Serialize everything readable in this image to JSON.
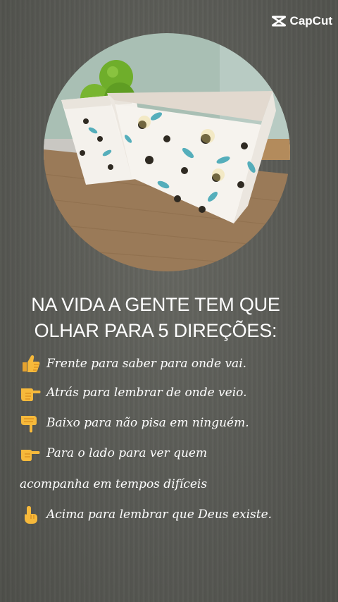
{
  "watermark": {
    "brand": "CapCut",
    "icon": "capcut-logo-icon"
  },
  "photo": {
    "icon": "ceramic-planters-photo"
  },
  "headline": {
    "line1": "NA VIDA A GENTE TEM QUE",
    "line2": "OLHAR PARA 5 DIREÇÕES:"
  },
  "directions": [
    {
      "emoji": "thumbs-up-icon",
      "text": "Frente para saber para onde vai."
    },
    {
      "emoji": "pointing-right-icon",
      "text": "Atrás para lembrar de onde veio."
    },
    {
      "emoji": "pointing-down-icon",
      "text": "Baixo para não pisa em ninguém."
    },
    {
      "emoji": "pointing-side-icon",
      "text": "Para o lado para ver quem"
    },
    {
      "emoji": "",
      "text": "acompanha em tempos difíceis"
    },
    {
      "emoji": "pointing-up-icon",
      "text": "Acima para lembrar que Deus existe."
    }
  ],
  "colors": {
    "background": "#5b5c57",
    "text": "#ffffff",
    "emoji": "#f6b93b"
  }
}
